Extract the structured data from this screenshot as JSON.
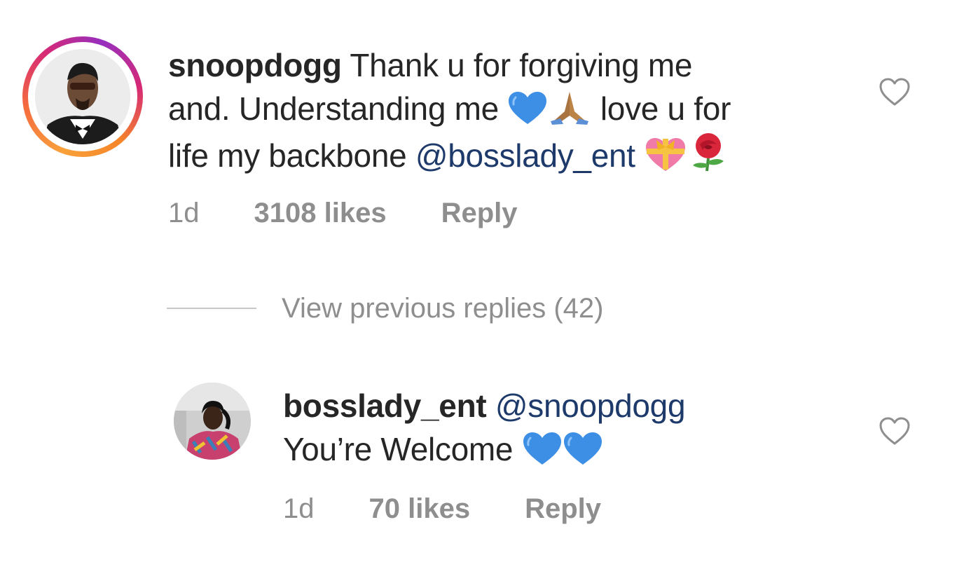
{
  "comment": {
    "username": "snoopdogg",
    "text_line1": "Thank u for forgiving me",
    "text_line2a": "and. Understanding me",
    "text_line2b": "love u for",
    "text_line3a": "life my backbone",
    "mention": "@bosslady_ent",
    "age": "1d",
    "likes": "3108 likes",
    "reply": "Reply"
  },
  "view_previous": "View previous replies (42)",
  "reply": {
    "username": "bosslady_ent",
    "mention": "@snoopdogg",
    "text": "You’re Welcome",
    "age": "1d",
    "likes": "70 likes",
    "reply": "Reply"
  },
  "icons": {
    "heart": "heart-outline-icon",
    "blue_heart": "blue-heart-emoji",
    "pray": "folded-hands-emoji",
    "gift_heart": "heart-with-ribbon-emoji",
    "rose": "rose-emoji"
  },
  "colors": {
    "mention": "#1d3a6b",
    "meta": "#8e8e8e",
    "emoji_blue": "#3d8fe6"
  }
}
